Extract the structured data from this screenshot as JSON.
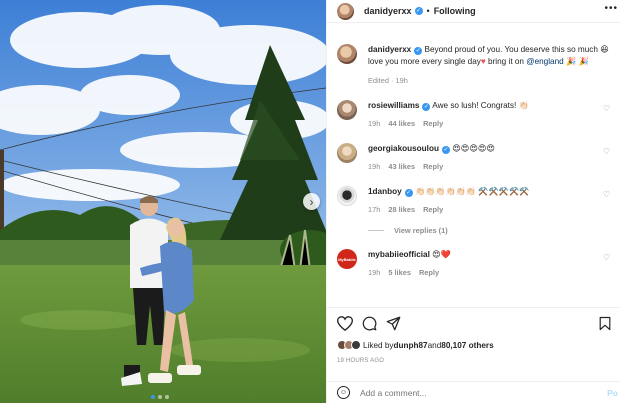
{
  "header": {
    "username": "danidyerxx",
    "separator": "•",
    "follow_state": "Following",
    "more_icon": "ellipsis-icon"
  },
  "comments": [
    {
      "username": "danidyerxx",
      "text_before_heart": " Beyond proud of you. You deserve this so much",
      "text_line2": "love you more every single day",
      "text_after_heart": " bring it on ",
      "mention": "@england",
      "trailing_emoji": " 🎉 🎉",
      "meta_time": "Edited · 19h"
    },
    {
      "username": "rosiewilliams",
      "text": " Awe so lush! Congrats! 👏🏻",
      "time": "19h",
      "likes": "44 likes",
      "reply": "Reply"
    },
    {
      "username": "georgiakousoulou",
      "text": " 😍😍😍😍😍",
      "time": "19h",
      "likes": "43 likes",
      "reply": "Reply"
    },
    {
      "username": "1danboy",
      "text": " 👏🏻👏🏻👏🏻👏🏻👏🏻👏🏻 ⚒️⚒️⚒️⚒️⚒️",
      "time": "17h",
      "likes": "28 likes",
      "reply": "Reply",
      "view_replies": "View replies (1)"
    },
    {
      "username": "mybabiieofficial",
      "text": " 😍❤️",
      "time": "19h",
      "likes": "5 likes",
      "reply": "Reply",
      "avatar_text": "MyBabiie"
    }
  ],
  "actions": {
    "liked_by_prefix": "Liked by ",
    "liked_by_user": "dunph87",
    "liked_by_and": " and ",
    "liked_by_count": "80,107 others",
    "time_ago": "19 HOURS AGO"
  },
  "add_comment": {
    "placeholder": "Add a comment...",
    "post_label": "Po"
  },
  "colors": {
    "verified": "#3897f0",
    "link": "#00376b",
    "muted": "#8e8e8e",
    "post_disabled": "#b2dffc",
    "heart": "#ed4956"
  }
}
